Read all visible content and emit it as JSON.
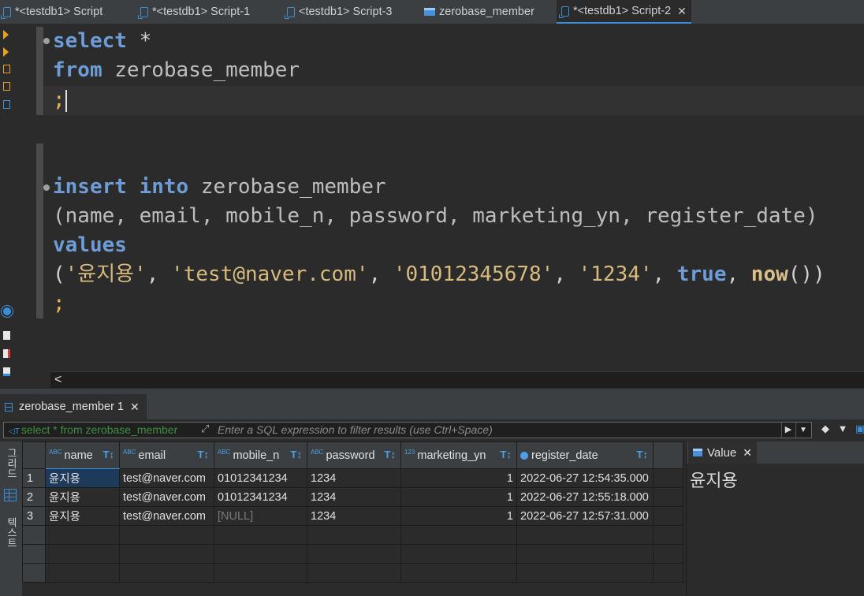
{
  "tabs": [
    {
      "label": "*<testdb1> Script",
      "icon": "script-icon"
    },
    {
      "label": "*<testdb1> Script-1",
      "icon": "script-icon"
    },
    {
      "label": "<testdb1> Script-3",
      "icon": "script-icon"
    },
    {
      "label": "zerobase_member",
      "icon": "table-icon"
    },
    {
      "label": "*<testdb1> Script-2",
      "icon": "script-icon",
      "active": true,
      "close": "✕"
    }
  ],
  "editor": {
    "select_kw": "select",
    "select_star": " *",
    "from_kw": "from",
    "from_table": " zerobase_member",
    "semicolon": ";",
    "insert_kw": "insert",
    "into_kw": "into",
    "insert_table": " zerobase_member",
    "columns_line": "(name, email, mobile_n, password, marketing_yn, register_date)",
    "values_kw": "values",
    "v_open": "(",
    "v_name": "'윤지용'",
    "v_sep1": ", ",
    "v_email": "'test@naver.com'",
    "v_sep2": ", ",
    "v_mobile": "'01012345678'",
    "v_sep3": ", ",
    "v_pass": "'1234'",
    "v_sep4": ", ",
    "v_true": "true",
    "v_sep5": ", ",
    "v_now": "now",
    "v_close": "())",
    "semicolon2": ";"
  },
  "hscroll": {
    "left_arrow": "<"
  },
  "results": {
    "tab_label": "zerobase_member 1",
    "tab_close": "✕",
    "filter_label": "select * from zerobase_member",
    "filter_placeholder": "Enter a SQL expression to filter results (use Ctrl+Space)",
    "columns": [
      "name",
      "email",
      "mobile_n",
      "password",
      "marketing_yn",
      "register_date"
    ],
    "column_types": [
      "ABC",
      "ABC",
      "ABC",
      "ABC",
      "123",
      "clock"
    ],
    "rows": [
      {
        "num": "1",
        "name": "윤지용",
        "email": "test@naver.com",
        "mobile_n": "01012341234",
        "password": "1234",
        "marketing_yn": "1",
        "register_date": "2022-06-27 12:54:35.000"
      },
      {
        "num": "2",
        "name": "윤지용",
        "email": "test@naver.com",
        "mobile_n": "01012341234",
        "password": "1234",
        "marketing_yn": "1",
        "register_date": "2022-06-27 12:55:18.000"
      },
      {
        "num": "3",
        "name": "윤지용",
        "email": "test@naver.com",
        "mobile_n": "[NULL]",
        "password": "1234",
        "marketing_yn": "1",
        "register_date": "2022-06-27 12:57:31.000"
      }
    ],
    "side_tabs": {
      "grid": "그리드",
      "text": "텍스트"
    }
  },
  "value_panel": {
    "title": "Value",
    "close": "✕",
    "content": "윤지용"
  },
  "colors": {
    "keyword": "#6d9cd6",
    "string": "#d7ba7d",
    "accent": "#3a8fd9",
    "background": "#2b2b2b"
  }
}
